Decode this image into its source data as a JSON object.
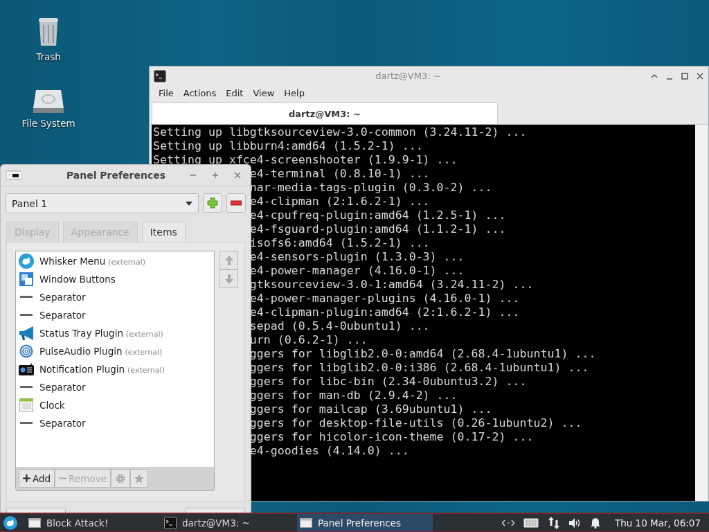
{
  "desktop_icons": [
    {
      "label": "Trash",
      "kind": "trash"
    },
    {
      "label": "File System",
      "kind": "drive"
    }
  ],
  "terminal": {
    "title": "dartz@VM3: ~",
    "menu": [
      "File",
      "Actions",
      "Edit",
      "View",
      "Help"
    ],
    "tabs": [
      {
        "label": "dartz@VM3: ~",
        "selected": true
      }
    ],
    "lines": [
      {
        "text": "Setting up libgtksourceview-3.0-common (3.24.11-2) ...",
        "kind": "full"
      },
      {
        "text": "Setting up libburn4:amd64 (1.5.2-1) ...",
        "kind": "full"
      },
      {
        "text": "Setting up xfce4-screenshooter (1.9.9-1) ...",
        "kind": "full"
      },
      {
        "text": "e4-terminal (0.8.10-1) ...",
        "kind": "clipped"
      },
      {
        "text": "nar-media-tags-plugin (0.3.0-2) ...",
        "kind": "clipped"
      },
      {
        "text": "e4-clipman (2:1.6.2-1) ...",
        "kind": "clipped"
      },
      {
        "text": "e4-cpufreq-plugin:amd64 (1.2.5-1) ...",
        "kind": "clipped"
      },
      {
        "text": "e4-fsguard-plugin:amd64 (1.1.2-1) ...",
        "kind": "clipped"
      },
      {
        "text": "isofs6:amd64 (1.5.2-1) ...",
        "kind": "clipped"
      },
      {
        "text": "e4-sensors-plugin (1.3.0-3) ...",
        "kind": "clipped"
      },
      {
        "text": "e4-power-manager (4.16.0-1) ...",
        "kind": "clipped"
      },
      {
        "text": "gtksourceview-3.0-1:amd64 (3.24.11-2) ...",
        "kind": "clipped"
      },
      {
        "text": "e4-power-manager-plugins (4.16.0-1) ...",
        "kind": "clipped"
      },
      {
        "text": "e4-clipman-plugin:amd64 (2:1.6.2-1) ...",
        "kind": "clipped"
      },
      {
        "text": "sepad (0.5.4-0ubuntu1) ...",
        "kind": "clipped"
      },
      {
        "text": "urn (0.6.2-1) ...",
        "kind": "clipped"
      },
      {
        "text": "ggers for libglib2.0-0:amd64 (2.68.4-1ubuntu1) ...",
        "kind": "clipped"
      },
      {
        "text": "ggers for libglib2.0-0:i386 (2.68.4-1ubuntu1) ...",
        "kind": "clipped"
      },
      {
        "text": "ggers for libc-bin (2.34-0ubuntu3.2) ...",
        "kind": "clipped"
      },
      {
        "text": "ggers for man-db (2.9.4-2) ...",
        "kind": "clipped"
      },
      {
        "text": "ggers for mailcap (3.69ubuntu1) ...",
        "kind": "clipped"
      },
      {
        "text": "ggers for desktop-file-utils (0.26-1ubuntu2) ...",
        "kind": "clipped"
      },
      {
        "text": "ggers for hicolor-icon-theme (0.17-2) ...",
        "kind": "clipped"
      },
      {
        "text": "e4-goodies (4.14.0) ...",
        "kind": "clipped"
      }
    ]
  },
  "panel_preferences": {
    "title": "Panel Preferences",
    "panel_select": "Panel 1",
    "tabs": [
      {
        "label": "Display",
        "selected": false
      },
      {
        "label": "Appearance",
        "selected": false
      },
      {
        "label": "Items",
        "selected": true
      }
    ],
    "items": [
      {
        "name": "Whisker Menu",
        "note": "(external)",
        "kind": "whisker"
      },
      {
        "name": "Window Buttons",
        "kind": "windows"
      },
      {
        "name": "Separator",
        "kind": "separator"
      },
      {
        "name": "Separator",
        "kind": "separator"
      },
      {
        "name": "Status Tray Plugin",
        "note": "(external)",
        "kind": "megaphone"
      },
      {
        "name": "PulseAudio Plugin",
        "note": "(external)",
        "kind": "audio"
      },
      {
        "name": "Notification Plugin",
        "note": "(external)",
        "kind": "notification"
      },
      {
        "name": "Separator",
        "kind": "separator"
      },
      {
        "name": "Clock",
        "kind": "calendar"
      },
      {
        "name": "Separator",
        "kind": "separator"
      }
    ],
    "toolbar": [
      {
        "label": "Add",
        "kind": "add",
        "disabled": false
      },
      {
        "label": "Remove",
        "kind": "remove",
        "disabled": true
      },
      {
        "kind": "gear",
        "disabled": true
      },
      {
        "kind": "star",
        "disabled": true
      }
    ]
  },
  "taskbar": {
    "tasks": [
      {
        "label": "Block Attack!",
        "kind": "window",
        "selected": false
      },
      {
        "label": "dartz@VM3: ~",
        "kind": "terminal",
        "selected": false
      },
      {
        "label": "Panel Preferences",
        "kind": "window",
        "selected": true
      }
    ],
    "clock": "Thu 10 Mar, 06:07"
  }
}
